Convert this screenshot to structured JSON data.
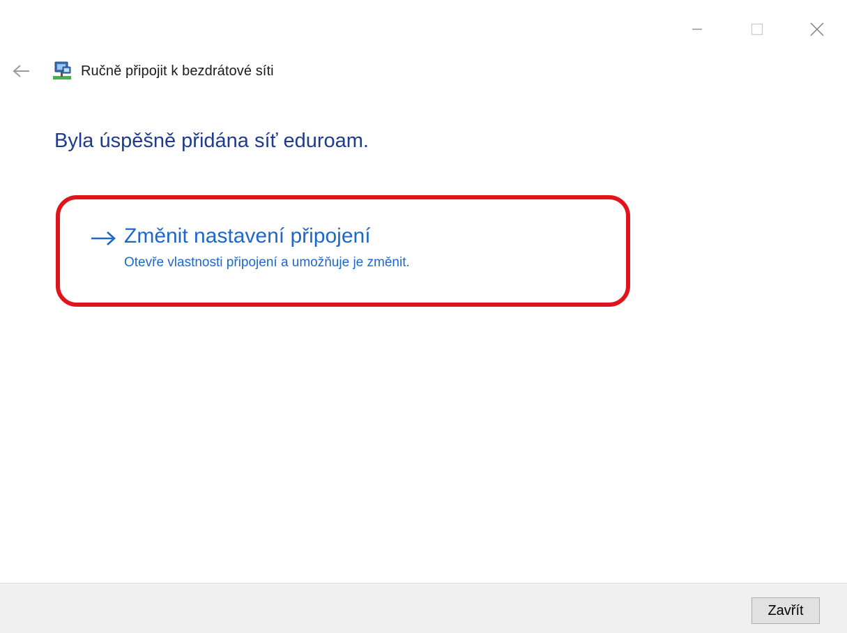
{
  "window": {
    "controls": [
      "minimize",
      "maximize",
      "close"
    ]
  },
  "header": {
    "back_icon": "back-arrow-icon",
    "network_icon": "network-icon",
    "title": "Ručně připojit k bezdrátové síti"
  },
  "main": {
    "heading": "Byla úspěšně přidána síť eduroam.",
    "command_link": {
      "icon": "right-arrow-icon",
      "title": "Změnit nastavení připojení",
      "description": "Otevře vlastnosti připojení a umožňuje je změnit."
    }
  },
  "footer": {
    "close_label": "Zavřít"
  },
  "colors": {
    "heading": "#1f3b8c",
    "link": "#1e67c9",
    "highlight": "#e0141c",
    "footer_bg": "#f0f0f0"
  }
}
